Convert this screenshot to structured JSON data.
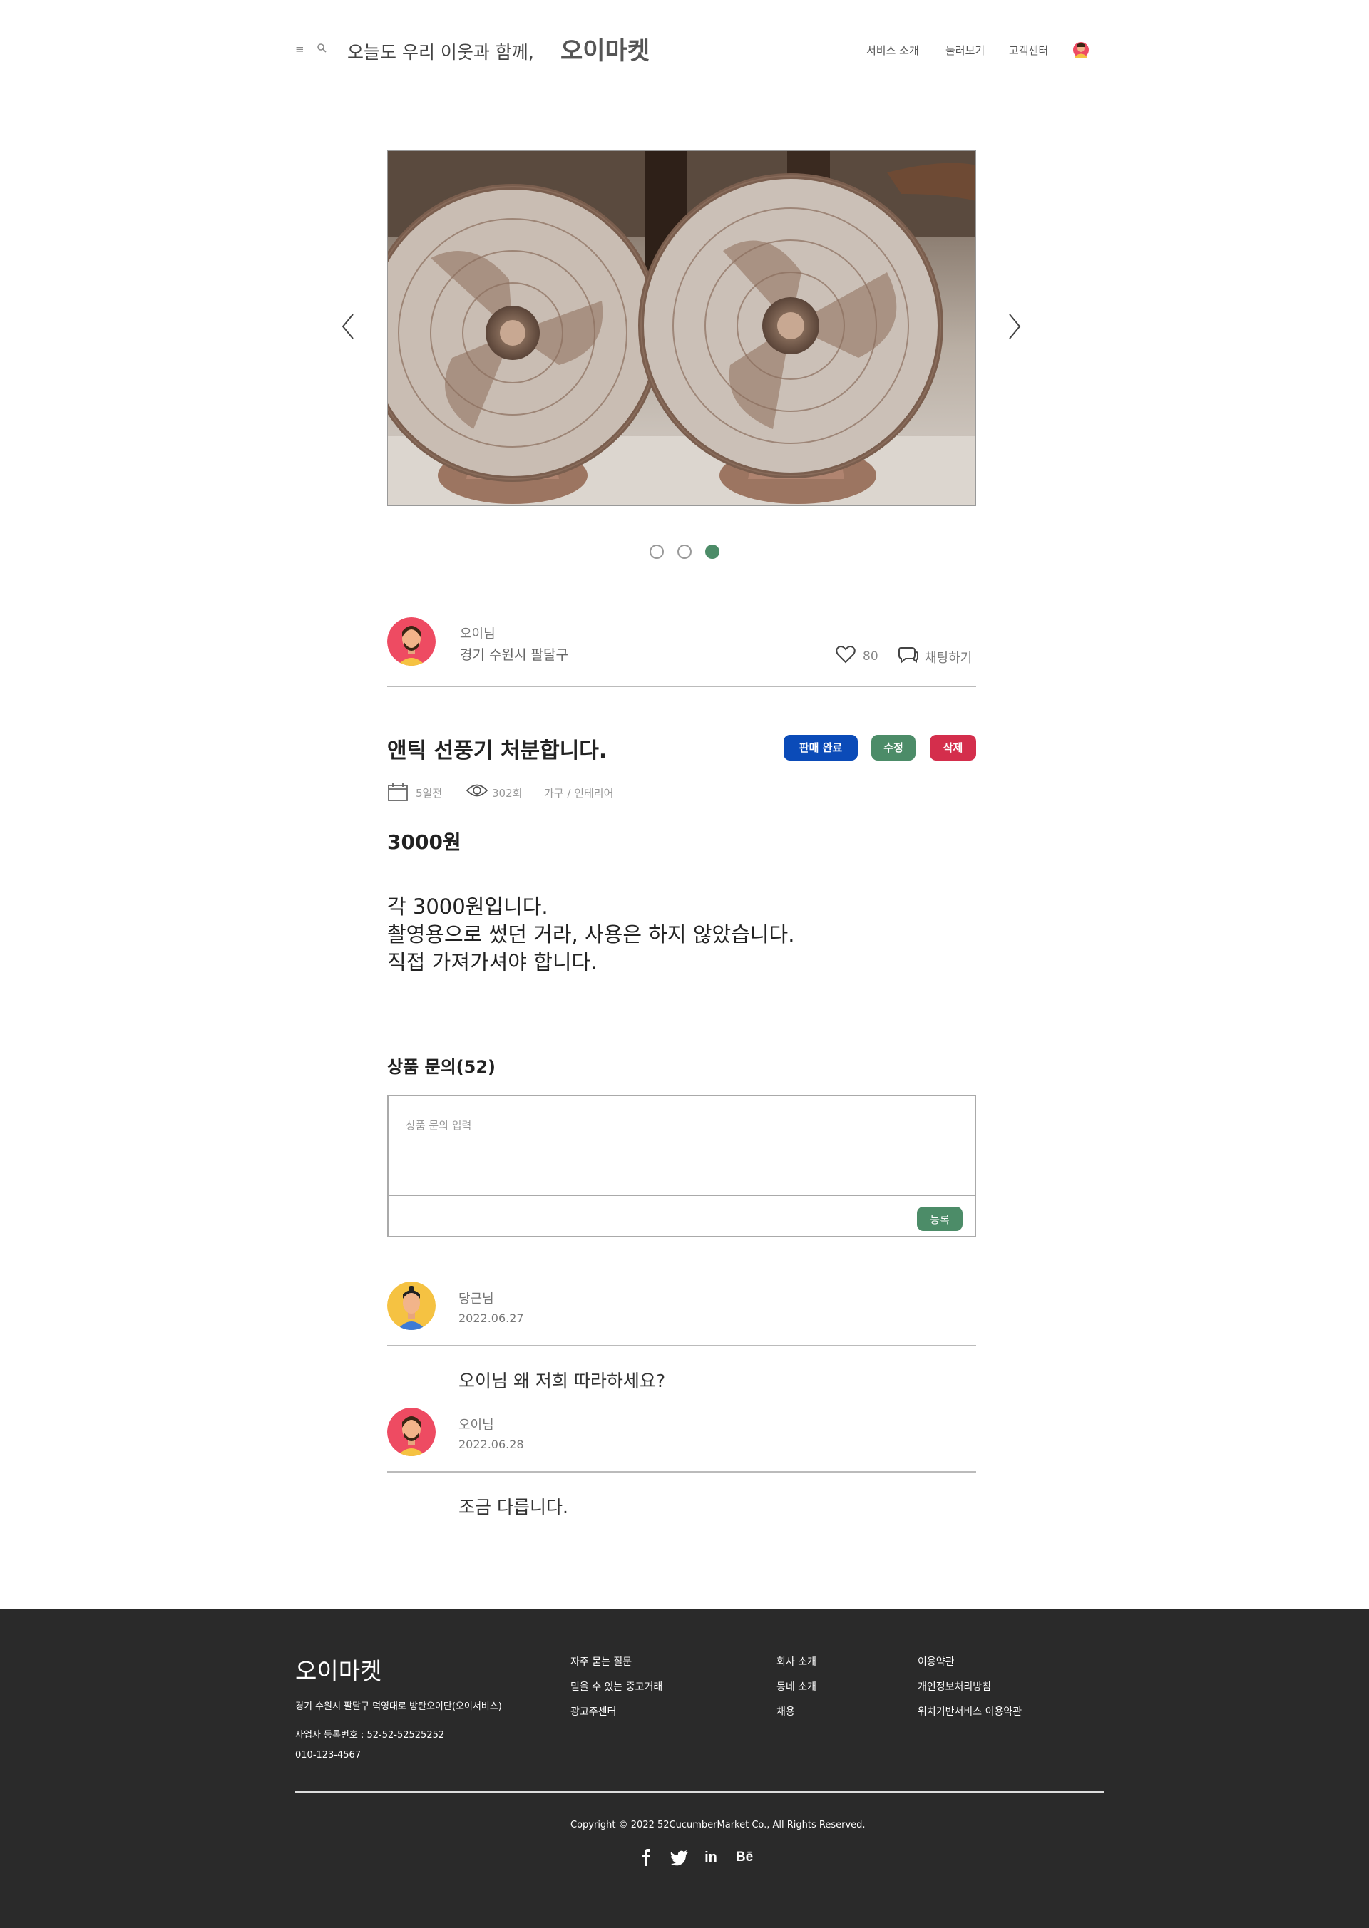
{
  "header": {
    "tagline": "오늘도 우리 이웃과 함께,",
    "brand": "오이마켓",
    "nav": [
      "서비스 소개",
      "둘러보기",
      "고객센터"
    ]
  },
  "carousel": {
    "slide_count": 3,
    "active_slide": 3
  },
  "seller": {
    "name": "오이님",
    "location": "경기 수원시 팔달구",
    "likes": "80",
    "chat_label": "채팅하기"
  },
  "product": {
    "title": "앤틱 선풍기 처분합니다.",
    "badges": {
      "sold": "판매 완료",
      "edit": "수정",
      "delete": "삭제"
    },
    "posted": "5일전",
    "views": "302회",
    "category": "가구 / 인테리어",
    "price": "3000원",
    "description": [
      "각 3000원입니다.",
      "촬영용으로 썼던 거라, 사용은 하지 않았습니다.",
      "직접 가져가셔야 합니다."
    ]
  },
  "inquiry": {
    "title": "상품 문의(52)",
    "placeholder": "상품 문의 입력",
    "submit_label": "등록",
    "comments": [
      {
        "author": "당근님",
        "date": "2022.06.27",
        "text": "오이님 왜 저희 따라하세요?"
      },
      {
        "author": "오이님",
        "date": "2022.06.28",
        "text": "조금 다릅니다."
      }
    ]
  },
  "footer": {
    "brand": "오이마켓",
    "address": "경기 수원시 팔달구 덕영대로 방탄오이단(오이서비스)",
    "business_number": "사업자 등록번호 : 52-52-52525252",
    "phone": "010-123-4567",
    "col1": [
      "자주 묻는 질문",
      "믿을 수 있는 중고거래",
      "광고주센터"
    ],
    "col2": [
      "회사 소개",
      "동네 소개",
      "채용"
    ],
    "col3": [
      "이용약관",
      "개인정보처리방침",
      "위치기반서비스 이용약관"
    ],
    "copyright": "Copyright © 2022 52CucumberMarket Co., All Rights Reserved.",
    "social": [
      "facebook-icon",
      "twitter-icon",
      "linkedin-icon",
      "behance-icon"
    ],
    "social_glyphs": [
      "f",
      "🐦",
      "in",
      "Bē"
    ]
  },
  "colors": {
    "accent_green": "#4c8c68",
    "sold_blue": "#0b4bb8",
    "delete_red": "#d42e4c",
    "footer_bg": "#2a2a2a"
  }
}
